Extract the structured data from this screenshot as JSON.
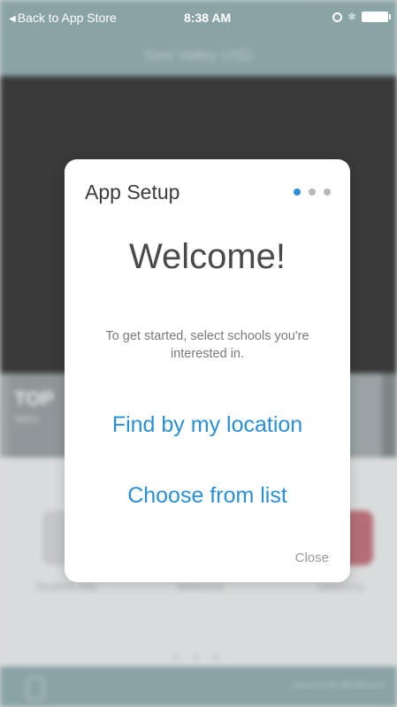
{
  "status_bar": {
    "back_label": "Back to App Store",
    "time": "8:38 AM"
  },
  "app": {
    "header_title": "Simi Valley USD",
    "tile_top": {
      "title": "TOP",
      "subtitle": "Webs"
    },
    "icon_labels": [
      "Student Info",
      "Welcome",
      "Directory"
    ],
    "powered_by": "powered by Blackboard"
  },
  "modal": {
    "title": "App Setup",
    "page_indicator": {
      "total": 3,
      "active_index": 0,
      "active_color": "#2a8fd6",
      "inactive_color": "#b8b8b8"
    },
    "heading": "Welcome!",
    "intro": "To get started, select schools you're interested in.",
    "find_location_label": "Find by my location",
    "choose_list_label": "Choose from list",
    "close_label": "Close",
    "link_color": "#2a8fd6"
  }
}
